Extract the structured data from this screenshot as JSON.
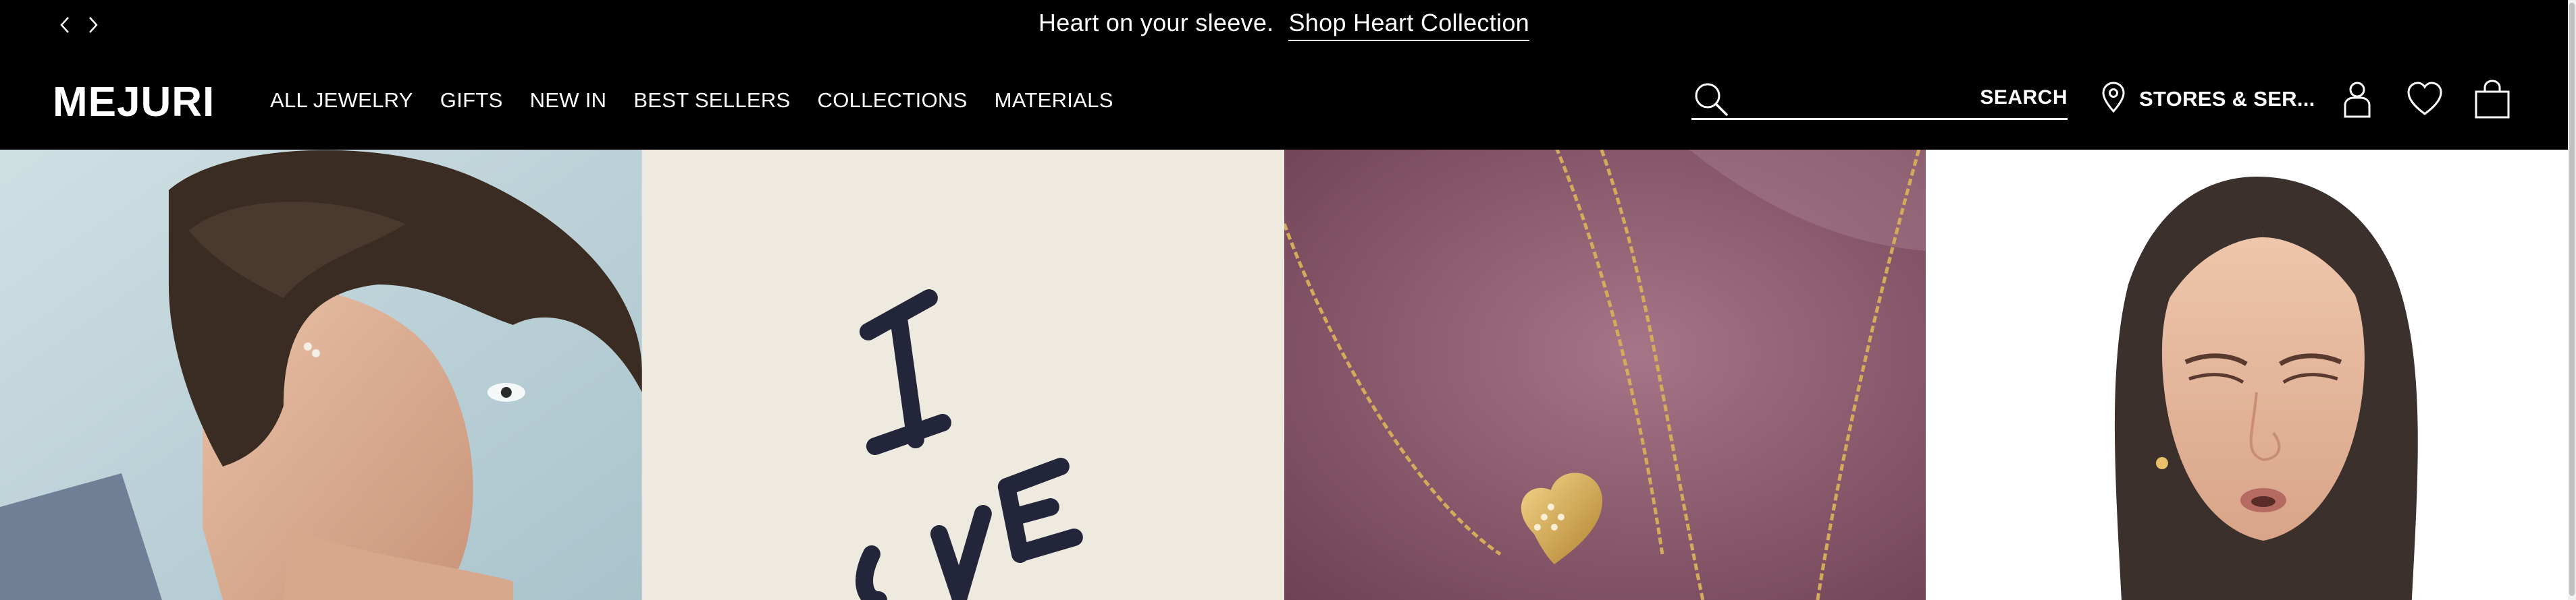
{
  "announcement": {
    "message": "Heart on your sleeve.",
    "link_label": "Shop Heart Collection",
    "prev_icon": "chevron-left-icon",
    "next_icon": "chevron-right-icon"
  },
  "header": {
    "logo": "MEJURI",
    "nav": [
      "ALL JEWELRY",
      "GIFTS",
      "NEW IN",
      "BEST SELLERS",
      "COLLECTIONS",
      "MATERIALS"
    ],
    "search": {
      "placeholder": "",
      "button_label": "SEARCH",
      "icon": "search-icon"
    },
    "stores_label": "STORES & SER...",
    "icons": [
      "location-pin-icon",
      "account-icon",
      "heart-icon",
      "bag-icon"
    ]
  },
  "tiles": [
    {
      "name": "model-earrings-photo"
    },
    {
      "name": "i-love-handwriting-photo"
    },
    {
      "name": "heart-necklace-photo"
    },
    {
      "name": "model-portrait-photo"
    }
  ],
  "colors": {
    "header_bg": "#000000",
    "header_text": "#ffffff",
    "tile_cream": "#eeeae0",
    "tile_mauve": "#8a5468",
    "gold": "#c9a04a"
  }
}
